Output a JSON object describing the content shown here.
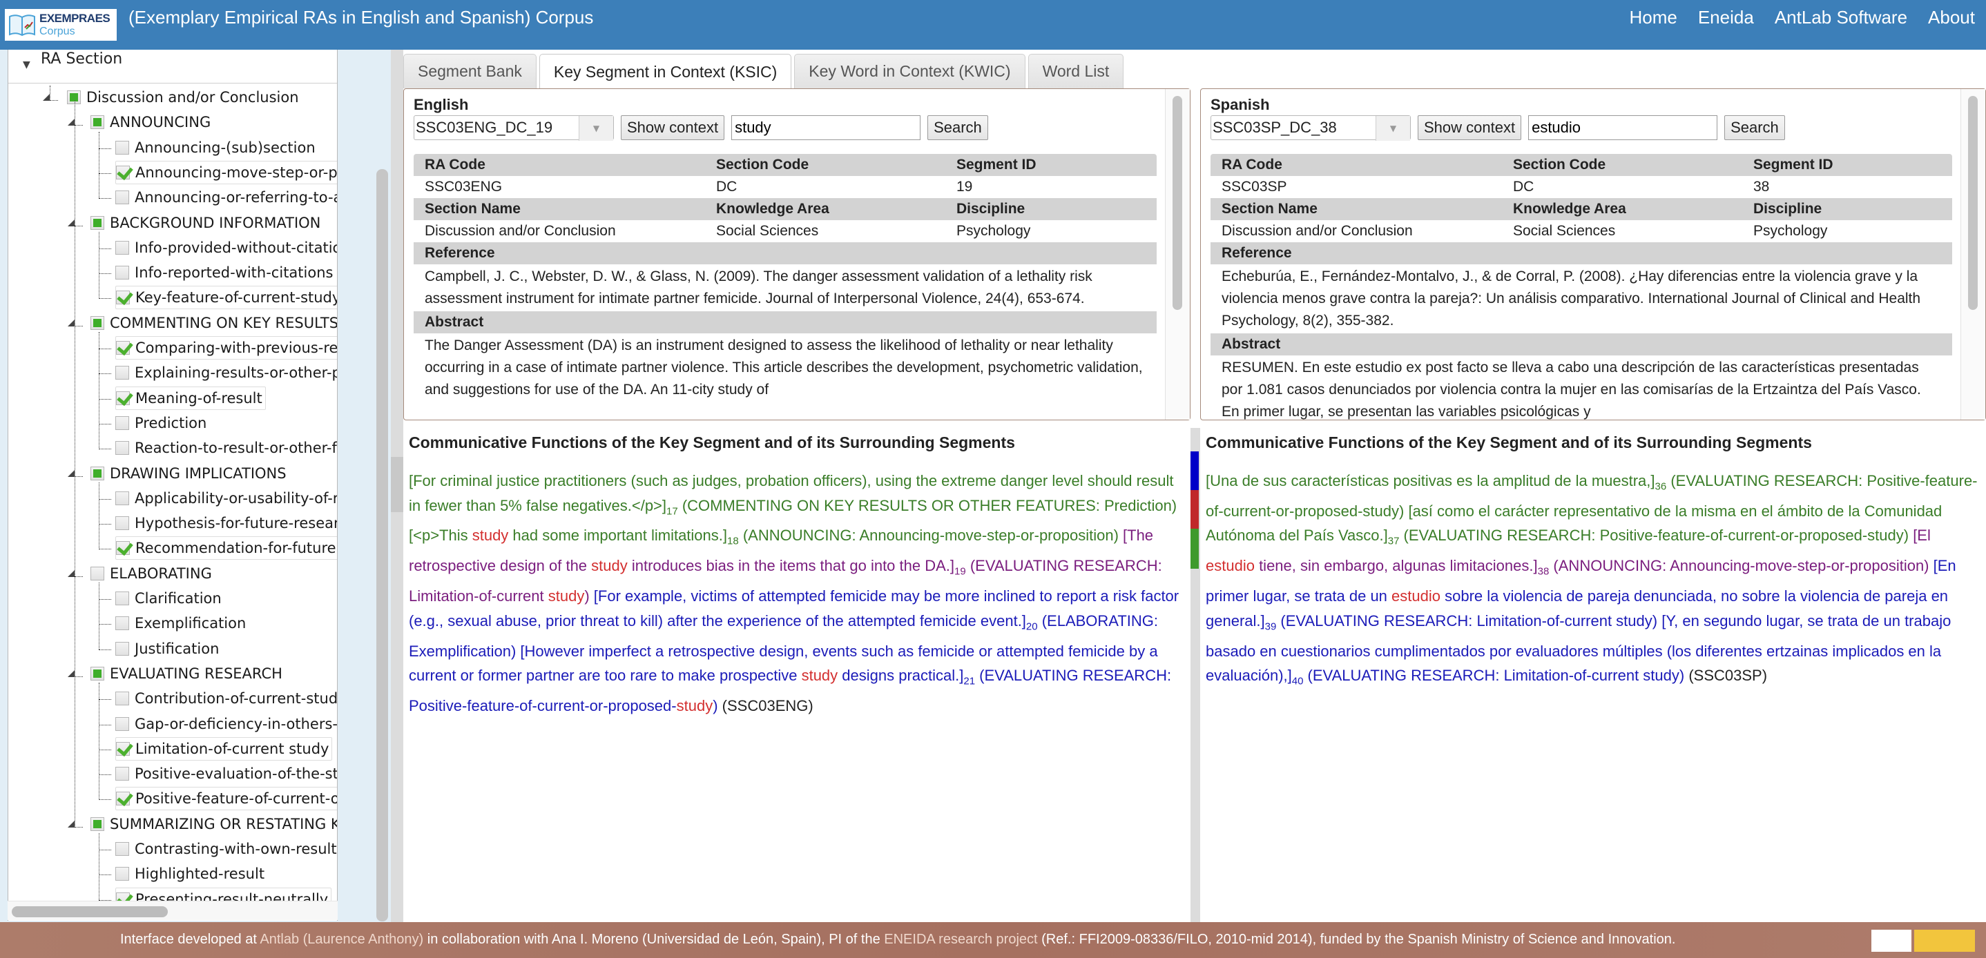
{
  "header": {
    "logo_line1": "EXEMPRAES",
    "logo_line2": "Corpus",
    "title": "(Exemplary Empirical RAs in English and Spanish) Corpus",
    "nav": [
      "Home",
      "Eneida",
      "AntLab Software",
      "About"
    ]
  },
  "sidebar": {
    "root_label": "RA Section",
    "section": {
      "label": "Discussion and/or Conclusion",
      "state": "partial"
    },
    "groups": [
      {
        "label": "ANNOUNCING",
        "state": "partial",
        "items": [
          {
            "label": "Announcing-(sub)section",
            "checked": false
          },
          {
            "label": "Announcing-move-step-or-proposition",
            "checked": true
          },
          {
            "label": "Announcing-or-referring-to-an-",
            "checked": false
          }
        ]
      },
      {
        "label": "BACKGROUND INFORMATION",
        "state": "partial",
        "items": [
          {
            "label": "Info-provided-without-citations",
            "checked": false
          },
          {
            "label": "Info-reported-with-citations",
            "checked": false
          },
          {
            "label": "Key-feature-of-current-study",
            "checked": true
          }
        ]
      },
      {
        "label": "COMMENTING ON KEY RESULTS OR OTHER FEATURES",
        "state": "partial",
        "items": [
          {
            "label": "Comparing-with-previous-research",
            "checked": true
          },
          {
            "label": "Explaining-results-or-other-phenomena",
            "checked": false
          },
          {
            "label": "Meaning-of-result",
            "checked": true
          },
          {
            "label": "Prediction",
            "checked": false
          },
          {
            "label": "Reaction-to-result-or-other-feature",
            "checked": false
          }
        ]
      },
      {
        "label": "DRAWING IMPLICATIONS",
        "state": "partial",
        "items": [
          {
            "label": "Applicability-or-usability-of-results",
            "checked": false
          },
          {
            "label": "Hypothesis-for-future-research",
            "checked": false
          },
          {
            "label": "Recommendation-for-future",
            "checked": true
          }
        ]
      },
      {
        "label": "ELABORATING",
        "state": "none",
        "items": [
          {
            "label": "Clarification",
            "checked": false
          },
          {
            "label": "Exemplification",
            "checked": false
          },
          {
            "label": "Justification",
            "checked": false
          }
        ]
      },
      {
        "label": "EVALUATING RESEARCH",
        "state": "partial",
        "items": [
          {
            "label": "Contribution-of-current-study",
            "checked": false
          },
          {
            "label": "Gap-or-deficiency-in-others-research",
            "checked": false
          },
          {
            "label": "Limitation-of-current study",
            "checked": true
          },
          {
            "label": "Positive-evaluation-of-the-state",
            "checked": false
          },
          {
            "label": "Positive-feature-of-current-or-proposed-study",
            "checked": true
          }
        ]
      },
      {
        "label": "SUMMARIZING OR RESTATING KEY RESULTS",
        "state": "partial",
        "items": [
          {
            "label": "Contrasting-with-own-results",
            "checked": false
          },
          {
            "label": "Highlighted-result",
            "checked": false
          },
          {
            "label": "Presenting-result-neutrally",
            "checked": true
          }
        ]
      }
    ]
  },
  "tabs": [
    {
      "label": "Segment Bank",
      "active": false
    },
    {
      "label": "Key Segment in Context (KSIC)",
      "active": true
    },
    {
      "label": "Key Word in Context (KWIC)",
      "active": false
    },
    {
      "label": "Word List",
      "active": false
    }
  ],
  "english": {
    "lang_label": "English",
    "segment_select": "SSC03ENG_DC_19",
    "show_context_label": "Show context",
    "search_value": "study",
    "search_label": "Search",
    "headers1": [
      "RA Code",
      "Section Code",
      "Segment ID"
    ],
    "values1": [
      "SSC03ENG",
      "DC",
      "19"
    ],
    "headers2": [
      "Section Name",
      "Knowledge Area",
      "Discipline"
    ],
    "values2": [
      "Discussion and/or Conclusion",
      "Social Sciences",
      "Psychology"
    ],
    "reference_label": "Reference",
    "reference": "Campbell, J. C., Webster, D. W., & Glass, N. (2009). The danger assessment validation of a lethality risk assessment instrument for intimate partner femicide. Journal of Interpersonal Violence, 24(4), 653-674.",
    "abstract_label": "Abstract",
    "abstract": "The Danger Assessment (DA) is an instrument designed to assess the likelihood of lethality or near lethality occurring in a case of intimate partner violence. This article describes the development, psychometric validation, and suggestions for use of the DA. An 11-city study of",
    "cf_title": "Communicative Functions of the Key Segment and of its Surrounding Segments",
    "segments": [
      {
        "color": "#3a7d28",
        "text": "[For criminal justice practitioners (such as judges, probation officers), using the extreme danger level should result in fewer than 5% false negatives.</p>]",
        "num": "17",
        "label": " (COMMENTING ON KEY RESULTS OR OTHER FEATURES: Prediction) "
      },
      {
        "color": "#3a7d28",
        "text": "[<p>This |study| had some important limitations.]",
        "num": "18",
        "label": " (ANNOUNCING: Announcing-move-step-or-proposition) "
      },
      {
        "color": "#7a1d7e",
        "text": "[The retrospective design of the |study| introduces bias in the items that go into the DA.]",
        "num": "19",
        "label": " (EVALUATING RESEARCH: Limitation-of-current |study|) "
      },
      {
        "color": "#1b1bb8",
        "text": "[For example, victims of attempted femicide may be more inclined to report a risk factor (e.g., sexual abuse, prior threat to kill) after the experience of the attempted femicide event.]",
        "num": "20",
        "label": " (ELABORATING: Exemplification) "
      },
      {
        "color": "#1b1bb8",
        "text": "[However imperfect a retrospective design, events such as femicide or attempted femicide by a current or former partner are too rare to make prospective |study| designs practical.]",
        "num": "21",
        "label": " (EVALUATING RESEARCH: Positive-feature-of-current-or-proposed-|study|) "
      }
    ],
    "source": "(SSC03ENG)"
  },
  "spanish": {
    "lang_label": "Spanish",
    "segment_select": "SSC03SP_DC_38",
    "show_context_label": "Show context",
    "search_value": "estudio",
    "search_label": "Search",
    "headers1": [
      "RA Code",
      "Section Code",
      "Segment ID"
    ],
    "values1": [
      "SSC03SP",
      "DC",
      "38"
    ],
    "headers2": [
      "Section Name",
      "Knowledge Area",
      "Discipline"
    ],
    "values2": [
      "Discussion and/or Conclusion",
      "Social Sciences",
      "Psychology"
    ],
    "reference_label": "Reference",
    "reference": "Echeburúa, E., Fernández-Montalvo, J., & de Corral, P. (2008). ¿Hay diferencias entre la violencia grave y la violencia menos grave contra la pareja?: Un análisis comparativo. International Journal of Clinical and Health Psychology, 8(2), 355-382.",
    "abstract_label": "Abstract",
    "abstract": "RESUMEN. En este estudio ex post facto se lleva a cabo una descripción de las características presentadas por 1.081 casos denunciados por violencia contra la mujer en las comisarías de la Ertzaintza del País Vasco. En primer lugar, se presentan las variables psicológicas y",
    "cf_title": "Communicative Functions of the Key Segment and of its Surrounding Segments",
    "segments": [
      {
        "color": "#3a7d28",
        "text": "[Una de sus características positivas es la amplitud de la muestra,]",
        "num": "36",
        "label": " (EVALUATING RESEARCH: Positive-feature-of-current-or-proposed-study) "
      },
      {
        "color": "#3a7d28",
        "text": "[así como el carácter representativo de la misma en el ámbito de la Comunidad Autónoma del País Vasco.]",
        "num": "37",
        "label": " (EVALUATING RESEARCH: Positive-feature-of-current-or-proposed-study) "
      },
      {
        "color": "#7a1d7e",
        "text": "[El |estudio| tiene, sin embargo, algunas limitaciones.]",
        "num": "38",
        "label": " (ANNOUNCING: Announcing-move-step-or-proposition) "
      },
      {
        "color": "#1b1bb8",
        "text": "[En primer lugar, se trata de un |estudio| sobre la violencia de pareja denunciada, no sobre la violencia de pareja en general.]",
        "num": "39",
        "label": " (EVALUATING RESEARCH: Limitation-of-current study) "
      },
      {
        "color": "#1b1bb8",
        "text": "[Y, en segundo lugar, se trata de un trabajo basado en cuestionarios cumplimentados por evaluadores múltiples (los diferentes ertzainas implicados en la evaluación),]",
        "num": "40",
        "label": " (EVALUATING RESEARCH: Limitation-of-current study) "
      }
    ],
    "source": "(SSC03SP)"
  },
  "colors": {
    "header_bg": "#3c7fb9",
    "footer_bg": "#a97565",
    "highlight": "#d32f2f",
    "marker_blue": "#0000c8",
    "marker_red": "#c0282a",
    "marker_green": "#3f9a2c"
  },
  "footer": {
    "prefix": "Interface developed at ",
    "antlab": "Antlab (Laurence Anthony)",
    "middle": " in collaboration with Ana I. Moreno (Universidad de León, Spain), PI of the ",
    "eneida": "ENEIDA research project",
    "suffix": " (Ref.: FFI2009-08336/FILO, 2010-mid 2014), funded by the Spanish Ministry of Science and Innovation."
  }
}
